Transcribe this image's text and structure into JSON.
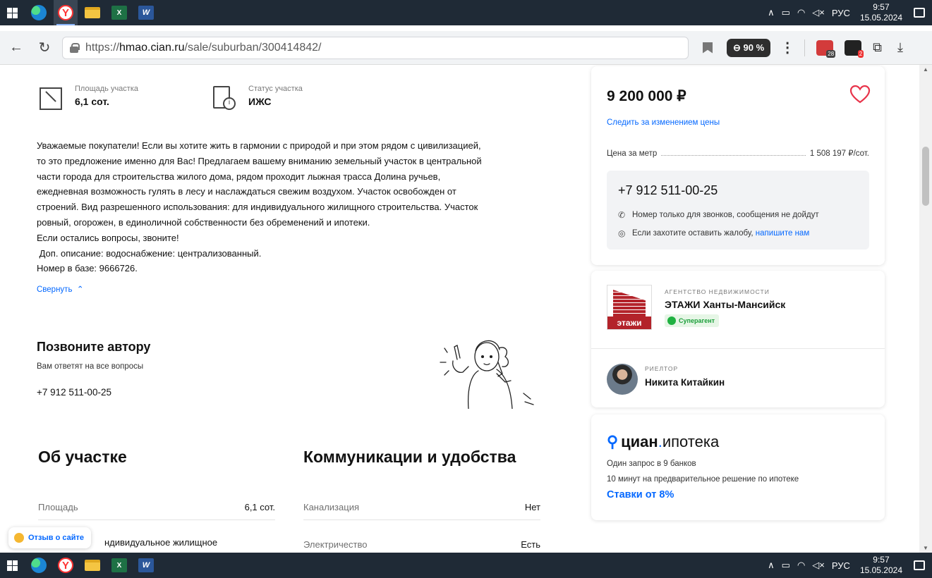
{
  "taskbar": {
    "apps": [
      "start",
      "edge",
      "yandex",
      "explorer",
      "excel",
      "word"
    ],
    "tray": {
      "lang": "РУС",
      "time": "9:57",
      "date": "15.05.2024"
    }
  },
  "browser": {
    "url_prefix": "https://",
    "url_host": "hmao.cian.ru",
    "url_path": "/sale/suburban/300414842/",
    "zoom": "90 %",
    "ext_badge_1": "28",
    "ext_badge_2": "2"
  },
  "features": [
    {
      "label": "Площадь участка",
      "value": "6,1 сот.",
      "icon": "area-icon"
    },
    {
      "label": "Статус участка",
      "value": "ИЖС",
      "icon": "document-info-icon"
    }
  ],
  "description": {
    "lines": [
      "Уважаемые покупатели! Если вы хотите жить в гармонии с природой и при этом рядом с цивилизацией,",
      "то это предложение именно для Вас! Предлагаем вашему вниманию земельный участок в центральной",
      "части города для строительства жилого дома, рядом проходит лыжная трасса Долина ручьев,",
      "ежедневная возможность гулять в лесу и наслаждаться свежим воздухом. Участок освобожден от",
      "строений. Вид разрешенного использования: для индивидуального жилищного строительства. Участок",
      "ровный, огорожен, в единоличной собственности без обременений и ипотеки.",
      "Если остались вопросы, звоните!",
      " Доп. описание: водоснабжение: централизованный.",
      "Номер в базе: 9666726."
    ],
    "collapse_label": "Свернуть"
  },
  "call_author": {
    "title": "Позвоните автору",
    "subtitle": "Вам ответят на все вопросы",
    "phone": "+7 912 511-00-25"
  },
  "about": {
    "title": "Об участке",
    "rows": [
      {
        "key": "Площадь",
        "value": "6,1 сот."
      }
    ],
    "partial_value": "ндивидуальное жилищное"
  },
  "communications": {
    "title": "Коммуникации и удобства",
    "rows": [
      {
        "key": "Канализация",
        "value": "Нет"
      },
      {
        "key": "Электричество",
        "value": "Есть"
      }
    ]
  },
  "feedback_button": "Отзыв о сайте",
  "price_card": {
    "price": "9 200 000 ₽",
    "watch_link": "Следить за изменением цены",
    "ppm_label": "Цена за метр",
    "ppm_value": "1 508 197 ₽/сот.",
    "phone": "+7 912 511-00-25",
    "note_calls": "Номер только для звонков, сообщения не дойдут",
    "note_complaint": "Если захотите оставить жалобу,",
    "note_complaint_link": "напишите нам"
  },
  "agency_card": {
    "agency_caption": "АГЕНТСТВО НЕДВИЖИМОСТИ",
    "agency_name": "ЭТАЖИ Ханты-Мансийск",
    "agency_logo_text": "этажи",
    "badge": "Суперагент",
    "realtor_caption": "РИЕЛТОР",
    "realtor_name": "Никита Китайкин"
  },
  "mortgage_card": {
    "brand_bold": "циан",
    "brand_dot": ".",
    "brand_light": "ипотека",
    "line1": "Один запрос в 9 банков",
    "line2": "10 минут на предварительное решение по ипотеке",
    "rate": "Ставки от 8%"
  }
}
